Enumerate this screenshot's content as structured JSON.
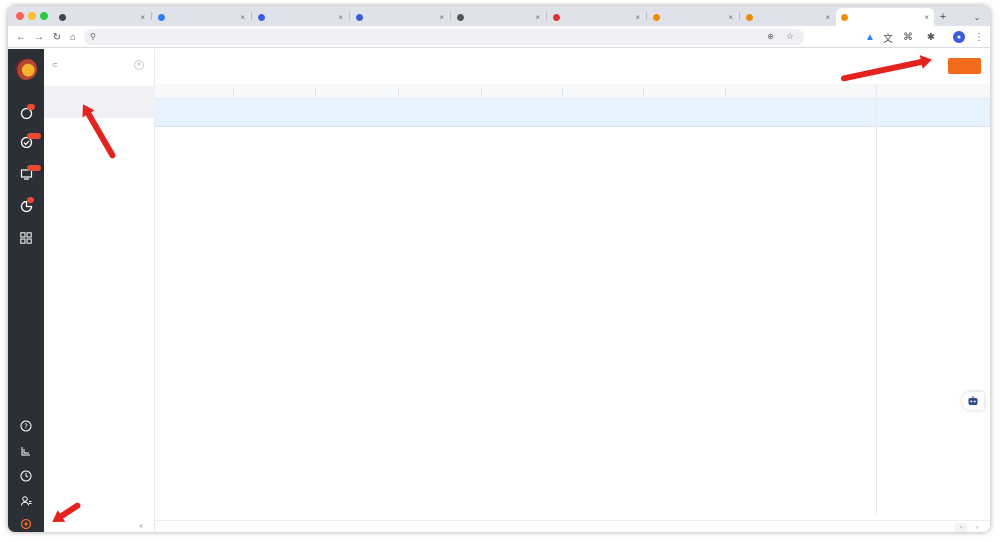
{
  "browser": {
    "tabs": [
      {
        "label": "",
        "favicon_color": "#444444"
      },
      {
        "label": "",
        "favicon_color": "#2f7cf6"
      },
      {
        "label": "",
        "favicon_color": "#3b5bdb"
      },
      {
        "label": "",
        "favicon_color": "#3b5bdb"
      },
      {
        "label": "",
        "favicon_color": "#555555"
      },
      {
        "label": "",
        "favicon_color": "#e03131"
      },
      {
        "label": "",
        "favicon_color": "#f08c00"
      },
      {
        "label": "",
        "favicon_color": "#f08c00"
      },
      {
        "label": "",
        "favicon_color": "#f08c00",
        "active": true
      }
    ],
    "url": ""
  },
  "sidebar": {
    "items": [
      {
        "icon": "bubble-icon",
        "label": "",
        "badge": ""
      },
      {
        "icon": "check-circle-icon",
        "label": "",
        "badge": ""
      },
      {
        "icon": "monitor-icon",
        "label": "",
        "badge": ""
      },
      {
        "icon": "crm-icon",
        "label": "",
        "badge": ""
      },
      {
        "icon": "grid-icon",
        "label": ""
      }
    ],
    "bottom": [
      "help-icon",
      "stack-icon",
      "clock-icon",
      "people-icon",
      "settings-icon"
    ]
  },
  "panel": {
    "search_placeholder": "",
    "selected_item": {
      "title": "",
      "subtitle": ""
    }
  },
  "main": {
    "title": "",
    "new_button": "",
    "table": {
      "headers": [
        "",
        "",
        "",
        "",
        "",
        "",
        "",
        "",
        ""
      ],
      "rows": [
        {
          "cells": [
            "",
            "",
            "",
            "",
            "",
            "",
            "",
            ""
          ],
          "actions": [
            "",
            "",
            ""
          ]
        }
      ]
    },
    "pager": {
      "total": "",
      "size": ""
    }
  },
  "colors": {
    "accent": "#f26b1d",
    "link": "#2f7cf6",
    "row_highlight": "#e6f2fd",
    "rail": "#2b2f36"
  }
}
